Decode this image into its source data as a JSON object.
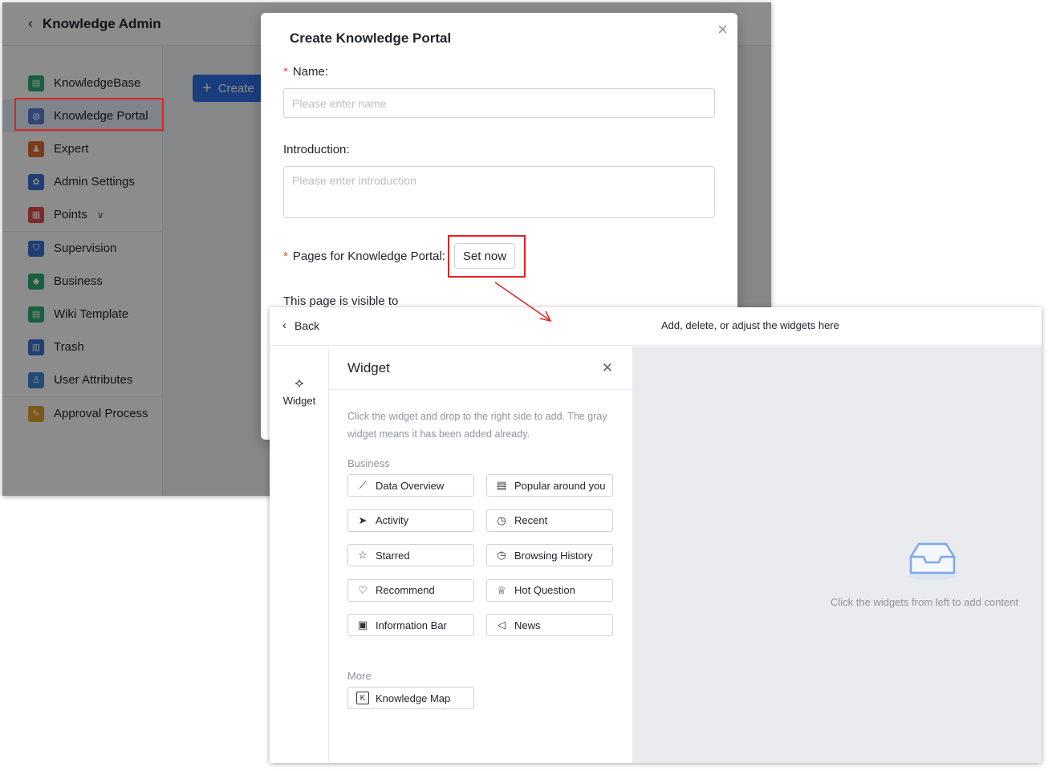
{
  "admin": {
    "title": "Knowledge Admin",
    "create_label": "Create",
    "sidebar": [
      {
        "label": "KnowledgeBase",
        "color": "#2cae74",
        "icon": "book-icon",
        "glyph": "▤"
      },
      {
        "label": "Knowledge Portal",
        "color": "#5b7fd6",
        "icon": "portal-icon",
        "glyph": "◍",
        "selected": true
      },
      {
        "label": "Expert",
        "color": "#e36a2e",
        "icon": "person-icon",
        "glyph": "♟"
      },
      {
        "label": "Admin Settings",
        "color": "#3b6fd8",
        "icon": "settings-icon",
        "glyph": "✿"
      },
      {
        "label": "Points",
        "color": "#e34d4d",
        "icon": "points-icon",
        "glyph": "▦",
        "expandable": true
      },
      {
        "label": "Supervision",
        "color": "#3b6fd8",
        "icon": "shield-icon",
        "glyph": "⛉"
      },
      {
        "label": "Business",
        "color": "#2cae74",
        "icon": "tag-icon",
        "glyph": "◆"
      },
      {
        "label": "Wiki Template",
        "color": "#2cae74",
        "icon": "template-icon",
        "glyph": "▤"
      },
      {
        "label": "Trash",
        "color": "#3b6fd8",
        "icon": "trash-icon",
        "glyph": "▥"
      },
      {
        "label": "User Attributes",
        "color": "#3b8ad8",
        "icon": "user-attributes-icon",
        "glyph": "♙"
      },
      {
        "label": "Approval Process",
        "color": "#e3a02e",
        "icon": "approval-icon",
        "glyph": "✎"
      }
    ]
  },
  "modal": {
    "title": "Create Knowledge Portal",
    "name_label": "Name:",
    "name_placeholder": "Please enter name",
    "intro_label": "Introduction:",
    "intro_placeholder": "Please enter introduction",
    "pages_label": "Pages for Knowledge Portal:",
    "set_now": "Set now",
    "visible_label": "This page is visible to"
  },
  "editor": {
    "back": "Back",
    "hint": "Add, delete, or adjust the widgets here",
    "rail_label": "Widget",
    "panel_title": "Widget",
    "description": "Click the widget and drop to the right side to add. The gray widget means it has been added already.",
    "groups": [
      {
        "label": "Business",
        "items": [
          {
            "label": "Data Overview",
            "icon": "chart-line-icon",
            "glyph": "⟋"
          },
          {
            "label": "Popular around you",
            "icon": "popular-doc-icon",
            "glyph": "▤"
          },
          {
            "label": "Activity",
            "icon": "send-icon",
            "glyph": "➤"
          },
          {
            "label": "Recent",
            "icon": "clock-icon",
            "glyph": "◷"
          },
          {
            "label": "Starred",
            "icon": "star-icon",
            "glyph": "☆"
          },
          {
            "label": "Browsing History",
            "icon": "history-icon",
            "glyph": "◷"
          },
          {
            "label": "Recommend",
            "icon": "thumbs-up-icon",
            "glyph": "♡"
          },
          {
            "label": "Hot Question",
            "icon": "trophy-icon",
            "glyph": "♕"
          },
          {
            "label": "Information Bar",
            "icon": "clipboard-icon",
            "glyph": "▣"
          },
          {
            "label": "News",
            "icon": "speaker-icon",
            "glyph": "◁"
          }
        ]
      },
      {
        "label": "More",
        "items": [
          {
            "label": "Knowledge Map",
            "icon": "k-box-icon",
            "glyph": "K"
          }
        ]
      }
    ],
    "empty_text": "Click the widgets from left to add content"
  }
}
